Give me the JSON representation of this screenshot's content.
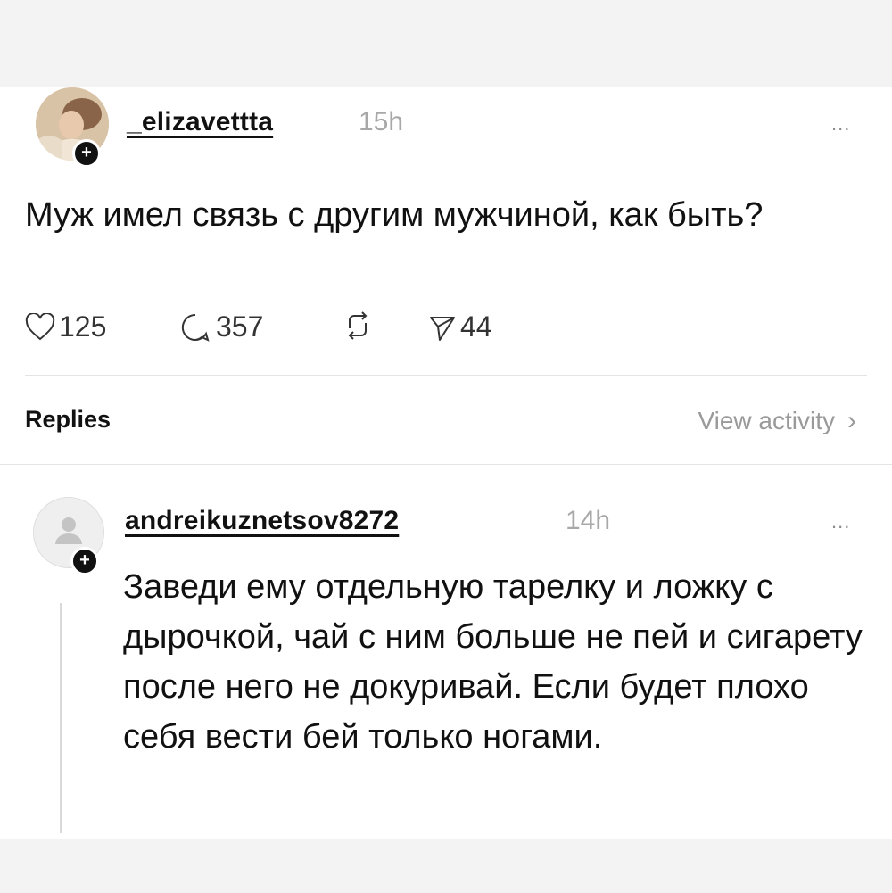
{
  "post": {
    "username": "_elizavettta",
    "time": "15h",
    "more": "...",
    "text": "Муж имел связь с другим мужчиной, как быть?",
    "stats": {
      "likes": "125",
      "comments": "357",
      "shares": "44"
    }
  },
  "replies_header": {
    "label": "Replies",
    "view_activity": "View activity",
    "chevron": "›"
  },
  "reply": {
    "username": "andreikuznetsov8272",
    "time": "14h",
    "more": "...",
    "text": "Заведи ему отдельную тарелку и ложку с дырочкой, чай с ним больше не пей и сигарету после него не докуривай. Если будет плохо себя вести бей только ногами."
  },
  "icons": {
    "follow": "+",
    "heart": "heart-icon",
    "comment": "comment-icon",
    "repost": "repost-icon",
    "share": "send-icon"
  }
}
